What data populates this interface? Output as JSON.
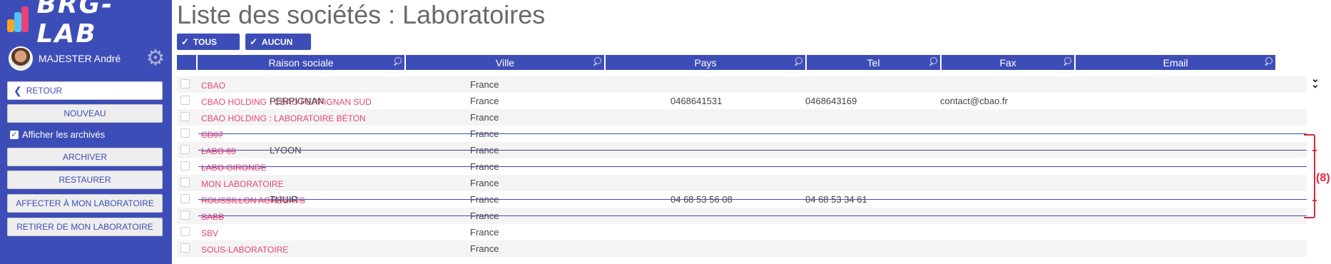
{
  "app": {
    "logo_text": "BRG-LAB"
  },
  "user": {
    "name": "MAJESTER André"
  },
  "sidebar": {
    "back_label": "RETOUR",
    "new_label": "NOUVEAU",
    "show_archived_label": "Afficher les archivés",
    "archive_label": "ARCHIVER",
    "restore_label": "RESTAURER",
    "assign_label": "AFFECTER À MON LABORATOIRE",
    "remove_label": "RETIRER DE MON LABORATOIRE"
  },
  "page": {
    "title": "Liste des sociétés : Laboratoires"
  },
  "selection": {
    "all_label": "TOUS",
    "none_label": "AUCUN"
  },
  "table": {
    "columns": [
      "Raison sociale",
      "Ville",
      "Pays",
      "Tel",
      "Fax",
      "Email"
    ],
    "rows": [
      {
        "name": "CBAO",
        "city": "",
        "country": "France",
        "tel": "",
        "fax": "",
        "email": "",
        "archived": false
      },
      {
        "name": "CBAO HOLDING : CBAO PERPIGNAN SUD",
        "city": "PERPIGNAN",
        "country": "France",
        "tel": "0468641531",
        "fax": "0468643169",
        "email": "contact@cbao.fr",
        "archived": false
      },
      {
        "name": "CBAO HOLDING : LABORATOIRE BÉTON",
        "city": "",
        "country": "France",
        "tel": "",
        "fax": "",
        "email": "",
        "archived": false
      },
      {
        "name": "CD07",
        "city": "",
        "country": "France",
        "tel": "",
        "fax": "",
        "email": "",
        "archived": true
      },
      {
        "name": "LABO 69",
        "city": "LYOON",
        "country": "France",
        "tel": "",
        "fax": "",
        "email": "",
        "archived": true
      },
      {
        "name": "LABO GIRONDE",
        "city": "",
        "country": "France",
        "tel": "",
        "fax": "",
        "email": "",
        "archived": true
      },
      {
        "name": "MON LABORATOIRE",
        "city": "",
        "country": "France",
        "tel": "",
        "fax": "",
        "email": "",
        "archived": false
      },
      {
        "name": "ROUSSILLON AGRÉGATS",
        "city": "THUIR",
        "country": "France",
        "tel": "04 68 53 56 08",
        "fax": "04 68 53 34 61",
        "email": "",
        "archived": true
      },
      {
        "name": "SABB",
        "city": "",
        "country": "France",
        "tel": "",
        "fax": "",
        "email": "",
        "archived": true
      },
      {
        "name": "SBV",
        "city": "",
        "country": "France",
        "tel": "",
        "fax": "",
        "email": "",
        "archived": false
      },
      {
        "name": "SOUS-LABORATOIRE",
        "city": "",
        "country": "France",
        "tel": "",
        "fax": "",
        "email": "",
        "archived": false
      }
    ]
  },
  "annotation": {
    "count_label": "(8)",
    "color": "#e0283c"
  },
  "colors": {
    "accent": "#3d4db7",
    "link": "#e5457d"
  },
  "icons": {
    "gear": "gear-icon",
    "back": "chevron-left-icon",
    "check": "check-icon",
    "search": "search-icon",
    "expand": "double-chevron-down-icon"
  }
}
